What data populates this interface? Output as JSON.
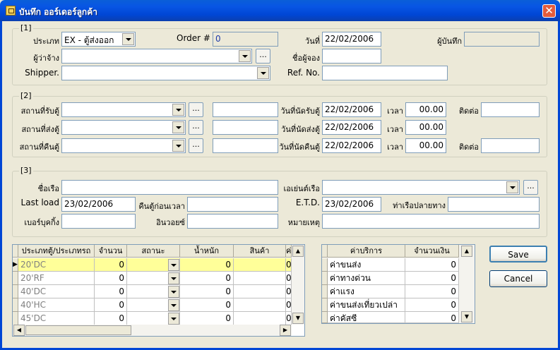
{
  "window": {
    "title": "บันทึก ออร์เดอร์ลูกค้า",
    "close": "✕"
  },
  "g1": {
    "label": "[1]",
    "type_label": "ประเภท",
    "type_value": "EX - ตู้ส่งออก",
    "order_label": "Order #",
    "order_value": "0",
    "date_label": "วันที่",
    "date_value": "22/02/2006",
    "recorder_label": "ผู้บันทึก",
    "recorder_value": "",
    "employer_label": "ผู้ว่าจ้าง",
    "employer_value": "",
    "booker_label": "ชื่อผู้จอง",
    "booker_value": "",
    "shipper_label": "Shipper.",
    "shipper_value": "",
    "ref_label": "Ref. No.",
    "ref_value": ""
  },
  "g2": {
    "label": "[2]",
    "rows": [
      {
        "place_label": "สถานที่รับตู้",
        "place_value": "",
        "extra": "",
        "date_label": "วันที่นัดรับตู้",
        "date_value": "22/02/2006",
        "time_label": "เวลา",
        "time_value": "00.00",
        "contact_label": "ติดต่อ",
        "contact_value": ""
      },
      {
        "place_label": "สถานที่ส่งตู้",
        "place_value": "",
        "extra": "",
        "date_label": "วันที่นัดส่งตู้",
        "date_value": "22/02/2006",
        "time_label": "เวลา",
        "time_value": "00.00",
        "contact_label": "",
        "contact_value": ""
      },
      {
        "place_label": "สถานที่คืนตู้",
        "place_value": "",
        "extra": "",
        "date_label": "วันที่นัดคืนตู้",
        "date_value": "22/02/2006",
        "time_label": "เวลา",
        "time_value": "00.00",
        "contact_label": "ติดต่อ",
        "contact_value": ""
      }
    ],
    "ellipsis": "..."
  },
  "g3": {
    "label": "[3]",
    "ship_label": "ชื่อเรือ",
    "ship_value": "",
    "agent_label": "เอเย่นต์เรือ",
    "agent_value": "",
    "lastload_label": "Last load",
    "lastload_value": "23/02/2006",
    "return_before_label": "คืนตู้ก่อนเวลา",
    "return_before_value": "",
    "etd_label": "E.T.D.",
    "etd_value": "23/02/2006",
    "dest_port_label": "ท่าเรือปลายทาง",
    "dest_port_value": "",
    "booking_label": "เบอร์บุคกิ้ง",
    "booking_value": "",
    "invoice_label": "อินวอยซ์",
    "invoice_value": "",
    "note_label": "หมายเหตุ",
    "note_value": ""
  },
  "container_grid": {
    "headers": [
      "ประเภทตู้/ประเภทรถ",
      "จำนวน",
      "สถานะ",
      "น้ำหนัก",
      "สินค้า",
      "ค่"
    ],
    "rows": [
      {
        "type": "20'DC",
        "qty": "0",
        "weight": "0",
        "extra": "0"
      },
      {
        "type": "20'RF",
        "qty": "0",
        "weight": "0",
        "extra": "0"
      },
      {
        "type": "40'DC",
        "qty": "0",
        "weight": "0",
        "extra": "0"
      },
      {
        "type": "40'HC",
        "qty": "0",
        "weight": "0",
        "extra": "0"
      },
      {
        "type": "45'DC",
        "qty": "0",
        "weight": "0",
        "extra": "0"
      }
    ]
  },
  "service_grid": {
    "headers": [
      "ค่าบริการ",
      "จำนวนเงิน"
    ],
    "rows": [
      {
        "name": "ค่าขนส่ง",
        "amount": "0"
      },
      {
        "name": "ค่าทางด่วน",
        "amount": "0"
      },
      {
        "name": "ค่าแรง",
        "amount": "0"
      },
      {
        "name": "ค่าขนส่งเที่ยวเปล่า",
        "amount": "0"
      },
      {
        "name": "ค่าคัสซี",
        "amount": "0"
      }
    ]
  },
  "buttons": {
    "save": "Save",
    "cancel": "Cancel"
  }
}
